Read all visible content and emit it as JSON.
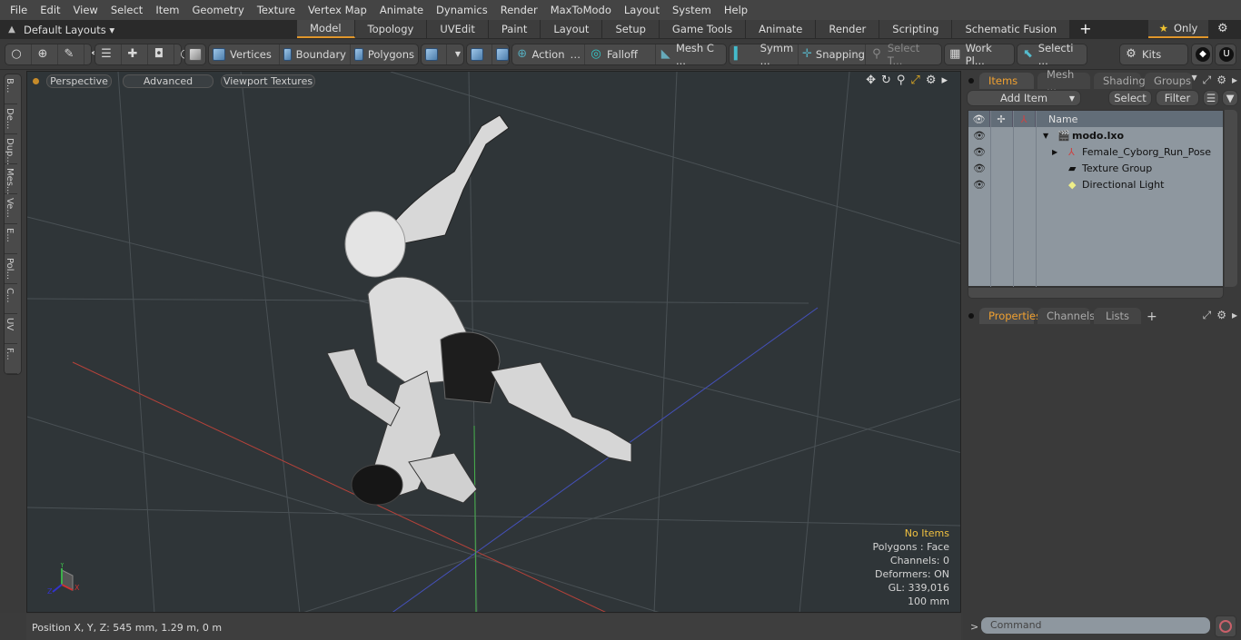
{
  "menu": [
    "File",
    "Edit",
    "View",
    "Select",
    "Item",
    "Geometry",
    "Texture",
    "Vertex Map",
    "Animate",
    "Dynamics",
    "Render",
    "MaxToModo",
    "Layout",
    "System",
    "Help"
  ],
  "layoutbar": {
    "layouts_label": "Default Layouts ▾",
    "tabs": [
      "Model",
      "Topology",
      "UVEdit",
      "Paint",
      "Layout",
      "Setup",
      "Game Tools",
      "Animate",
      "Render",
      "Scripting",
      "Schematic Fusion"
    ],
    "active_tab": "Model",
    "add_tab": "+",
    "only_label": "Only"
  },
  "toolbar": {
    "vertices": "Vertices",
    "boundary": "Boundary",
    "polygons": "Polygons",
    "action": "Action",
    "falloff": "Falloff",
    "mesh_c": "Mesh C ...",
    "symm": "Symm ...",
    "snapping": "Snapping",
    "select_t": "Select T...",
    "work_pl": "Work Pl...",
    "selecti": "Selecti ...",
    "kits": "Kits"
  },
  "left_tabs": [
    "B...",
    "De...",
    "Dup...",
    "Mes...",
    "Ve...",
    "E...",
    "Pol...",
    "C...",
    "UV",
    "F..."
  ],
  "viewport": {
    "view_mode": "Perspective",
    "shading": "Advanced",
    "textures": "Viewport Textures",
    "hud": {
      "selection": "No Items",
      "polygons": "Polygons : Face",
      "channels": "Channels: 0",
      "deformers": "Deformers: ON",
      "gl": "GL: 339,016",
      "scale": "100 mm"
    },
    "axis_labels": {
      "x": "X",
      "y": "Y",
      "z": "Z"
    }
  },
  "statusbar": {
    "position": "Position X, Y, Z:   545 mm, 1.29 m, 0 m"
  },
  "items_panel": {
    "tabs": [
      "Items",
      "Mesh ...",
      "Shading",
      "Groups"
    ],
    "active_tab": "Items",
    "add_item": "Add Item",
    "select": "Select",
    "filter": "Filter",
    "column_name": "Name",
    "items": [
      {
        "name": "modo.lxo",
        "bold": true,
        "level": 0
      },
      {
        "name": "Female_Cyborg_Run_Pose",
        "bold": false,
        "level": 1
      },
      {
        "name": "Texture Group",
        "bold": false,
        "level": 1
      },
      {
        "name": "Directional Light",
        "bold": false,
        "level": 1
      }
    ]
  },
  "props_panel": {
    "tabs": [
      "Properties",
      "Channels",
      "Lists"
    ],
    "active_tab": "Properties",
    "add": "+"
  },
  "command": {
    "prompt": ">",
    "placeholder": "Command"
  }
}
